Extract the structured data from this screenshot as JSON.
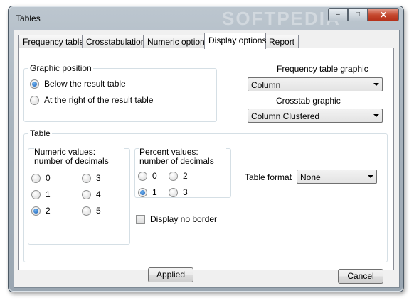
{
  "window": {
    "title": "Tables",
    "watermark": "SOFTPEDIA",
    "caption": {
      "minimize": "–",
      "maximize": "□",
      "close": "✕"
    }
  },
  "tabs": [
    {
      "label": "Frequency table",
      "active": false
    },
    {
      "label": "Crosstabulation",
      "active": false
    },
    {
      "label": "Numeric options",
      "active": false
    },
    {
      "label": "Display options",
      "active": true
    },
    {
      "label": "Report",
      "active": false
    }
  ],
  "graphic_position": {
    "label": "Graphic position",
    "options": [
      {
        "label": "Below the result table",
        "checked": true
      },
      {
        "label": "At the right of the result table",
        "checked": false
      }
    ]
  },
  "frequency_graphic": {
    "label": "Frequency table graphic",
    "value": "Column"
  },
  "crosstab_graphic": {
    "label": "Crosstab graphic",
    "value": "Column Clustered"
  },
  "table": {
    "label": "Table",
    "numeric_values": {
      "label": "Numeric values: number of decimals",
      "options": [
        {
          "label": "0",
          "checked": false
        },
        {
          "label": "1",
          "checked": false
        },
        {
          "label": "2",
          "checked": true
        },
        {
          "label": "3",
          "checked": false
        },
        {
          "label": "4",
          "checked": false
        },
        {
          "label": "5",
          "checked": false
        }
      ]
    },
    "percent_values": {
      "label": "Percent values: number of decimals",
      "options": [
        {
          "label": "0",
          "checked": false
        },
        {
          "label": "1",
          "checked": true
        },
        {
          "label": "2",
          "checked": false
        },
        {
          "label": "3",
          "checked": false
        }
      ]
    },
    "display_no_border": {
      "label": "Display no border",
      "checked": false
    },
    "table_format": {
      "label": "Table format",
      "value": "None"
    }
  },
  "buttons": {
    "applied": "Applied",
    "cancel": "Cancel"
  }
}
